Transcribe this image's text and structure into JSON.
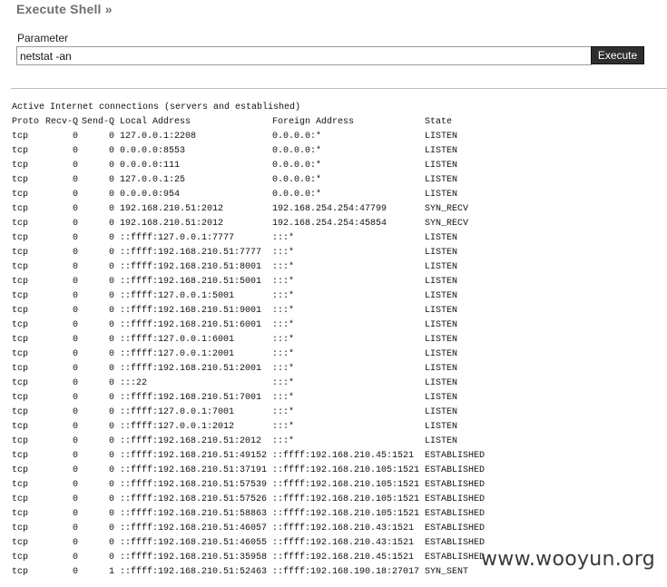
{
  "header": {
    "title": "Execute Shell »"
  },
  "form": {
    "label": "Parameter",
    "value": "netstat -an",
    "button": "Execute"
  },
  "output": {
    "intro": "Active Internet connections (servers and established)",
    "columns": [
      "Proto",
      "Recv-Q",
      "Send-Q",
      "Local Address",
      "Foreign Address",
      "State"
    ],
    "rows": [
      [
        "tcp",
        "0",
        "0",
        "127.0.0.1:2208",
        "0.0.0.0:*",
        "LISTEN"
      ],
      [
        "tcp",
        "0",
        "0",
        "0.0.0.0:8553",
        "0.0.0.0:*",
        "LISTEN"
      ],
      [
        "tcp",
        "0",
        "0",
        "0.0.0.0:111",
        "0.0.0.0:*",
        "LISTEN"
      ],
      [
        "tcp",
        "0",
        "0",
        "127.0.0.1:25",
        "0.0.0.0:*",
        "LISTEN"
      ],
      [
        "tcp",
        "0",
        "0",
        "0.0.0.0:954",
        "0.0.0.0:*",
        "LISTEN"
      ],
      [
        "tcp",
        "0",
        "0",
        "192.168.210.51:2012",
        "192.168.254.254:47799",
        "SYN_RECV"
      ],
      [
        "tcp",
        "0",
        "0",
        "192.168.210.51:2012",
        "192.168.254.254:45854",
        "SYN_RECV"
      ],
      [
        "tcp",
        "0",
        "0",
        "::ffff:127.0.0.1:7777",
        ":::*",
        "LISTEN"
      ],
      [
        "tcp",
        "0",
        "0",
        "::ffff:192.168.210.51:7777",
        ":::*",
        "LISTEN"
      ],
      [
        "tcp",
        "0",
        "0",
        "::ffff:192.168.210.51:8001",
        ":::*",
        "LISTEN"
      ],
      [
        "tcp",
        "0",
        "0",
        "::ffff:192.168.210.51:5001",
        ":::*",
        "LISTEN"
      ],
      [
        "tcp",
        "0",
        "0",
        "::ffff:127.0.0.1:5001",
        ":::*",
        "LISTEN"
      ],
      [
        "tcp",
        "0",
        "0",
        "::ffff:192.168.210.51:9001",
        ":::*",
        "LISTEN"
      ],
      [
        "tcp",
        "0",
        "0",
        "::ffff:192.168.210.51:6001",
        ":::*",
        "LISTEN"
      ],
      [
        "tcp",
        "0",
        "0",
        "::ffff:127.0.0.1:6001",
        ":::*",
        "LISTEN"
      ],
      [
        "tcp",
        "0",
        "0",
        "::ffff:127.0.0.1:2001",
        ":::*",
        "LISTEN"
      ],
      [
        "tcp",
        "0",
        "0",
        "::ffff:192.168.210.51:2001",
        ":::*",
        "LISTEN"
      ],
      [
        "tcp",
        "0",
        "0",
        ":::22",
        ":::*",
        "LISTEN"
      ],
      [
        "tcp",
        "0",
        "0",
        "::ffff:192.168.210.51:7001",
        ":::*",
        "LISTEN"
      ],
      [
        "tcp",
        "0",
        "0",
        "::ffff:127.0.0.1:7001",
        ":::*",
        "LISTEN"
      ],
      [
        "tcp",
        "0",
        "0",
        "::ffff:127.0.0.1:2012",
        ":::*",
        "LISTEN"
      ],
      [
        "tcp",
        "0",
        "0",
        "::ffff:192.168.210.51:2012",
        ":::*",
        "LISTEN"
      ],
      [
        "tcp",
        "0",
        "0",
        "::ffff:192.168.210.51:49152",
        "::ffff:192.168.210.45:1521",
        "ESTABLISHED"
      ],
      [
        "tcp",
        "0",
        "0",
        "::ffff:192.168.210.51:37191",
        "::ffff:192.168.210.105:1521",
        "ESTABLISHED"
      ],
      [
        "tcp",
        "0",
        "0",
        "::ffff:192.168.210.51:57539",
        "::ffff:192.168.210.105:1521",
        "ESTABLISHED"
      ],
      [
        "tcp",
        "0",
        "0",
        "::ffff:192.168.210.51:57526",
        "::ffff:192.168.210.105:1521",
        "ESTABLISHED"
      ],
      [
        "tcp",
        "0",
        "0",
        "::ffff:192.168.210.51:58863",
        "::ffff:192.168.210.105:1521",
        "ESTABLISHED"
      ],
      [
        "tcp",
        "0",
        "0",
        "::ffff:192.168.210.51:46057",
        "::ffff:192.168.210.43:1521",
        "ESTABLISHED"
      ],
      [
        "tcp",
        "0",
        "0",
        "::ffff:192.168.210.51:46055",
        "::ffff:192.168.210.43:1521",
        "ESTABLISHED"
      ],
      [
        "tcp",
        "0",
        "0",
        "::ffff:192.168.210.51:35958",
        "::ffff:192.168.210.45:1521",
        "ESTABLISHED"
      ],
      [
        "tcp",
        "0",
        "1",
        "::ffff:192.168.210.51:52463",
        "::ffff:192.168.190.18:27017",
        "SYN_SENT"
      ]
    ]
  },
  "watermark": "www.wooyun.org"
}
